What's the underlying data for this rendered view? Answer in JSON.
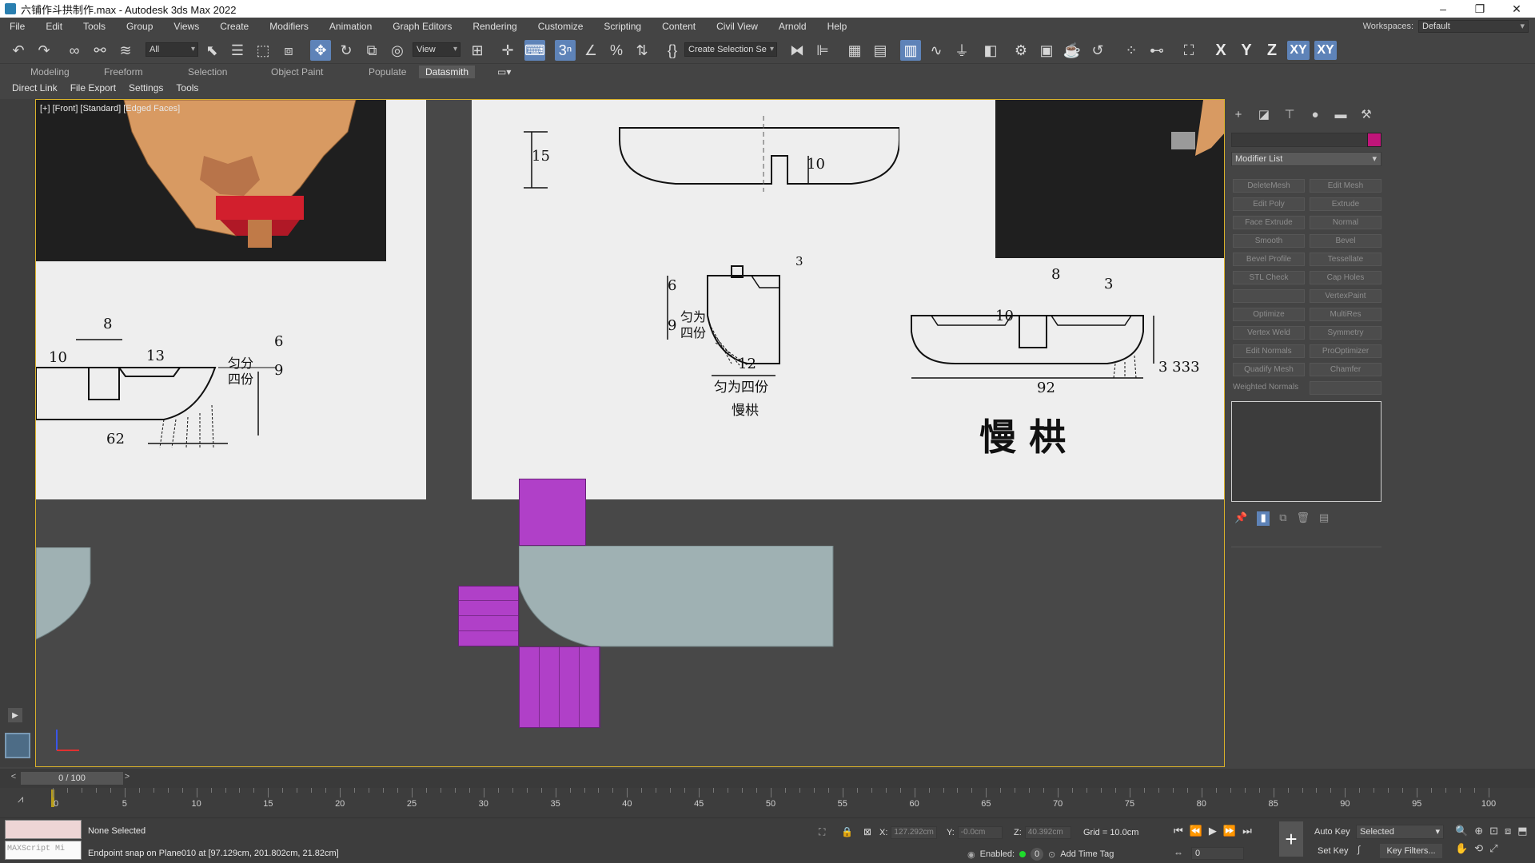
{
  "window": {
    "title": "六铺作斗拱制作.max - Autodesk 3ds Max 2022",
    "controls": [
      "–",
      "❐",
      "✕"
    ]
  },
  "menu": [
    "File",
    "Edit",
    "Tools",
    "Group",
    "Views",
    "Create",
    "Modifiers",
    "Animation",
    "Graph Editors",
    "Rendering",
    "Customize",
    "Scripting",
    "Content",
    "Civil View",
    "Arnold",
    "Help"
  ],
  "workspaces": {
    "label": "Workspaces:",
    "value": "Default"
  },
  "toolbar": {
    "filter_value": "All",
    "ref_coord_value": "View",
    "selection_set_placeholder": "Create Selection Se",
    "axes": [
      "X",
      "Y",
      "Z",
      "XY",
      "XY"
    ]
  },
  "ribbon": {
    "tabs": [
      "Modeling",
      "Freeform",
      "Selection",
      "Object Paint",
      "Populate",
      "Datasmith"
    ],
    "active_tab": "Datasmith",
    "subtabs": [
      "Direct Link",
      "File Export",
      "Settings",
      "Tools"
    ]
  },
  "viewport": {
    "label": "[+] [Front] [Standard] [Edged Faces]",
    "drawing_labels": {
      "dim_15": "15",
      "dim_10_top": "10",
      "dim_8_left": "8",
      "dim_10_left": "10",
      "dim_13_left": "13",
      "dim_6_left": "6",
      "dim_9_left": "9",
      "div4_left": "匀分\n四份",
      "dim_62": "62",
      "dim_3_mid": "3",
      "dim_6_mid": "6",
      "dim_9_mid": "9",
      "div4_mid_side": "匀为\n四份",
      "dim_12_mid": "12",
      "div4_mid": "匀为四份",
      "mangong_small": "慢栱",
      "dim_8_right": "8",
      "dim_3_right": "3",
      "dim_10_right": "10",
      "dim_3333": "3 333",
      "dim_92": "92",
      "mangong_large": "慢  栱"
    },
    "colors": {
      "accent_border": "#d9b12a",
      "purple_mesh": "#b040c8",
      "grey_mesh": "#9fb1b3",
      "blueprint_bg": "#eeeeee",
      "model_wood": "#d89a62",
      "model_red": "#d21f2d"
    }
  },
  "command_panel": {
    "tabs": [
      "create-icon",
      "modify-icon",
      "hierarchy-icon",
      "motion-icon",
      "display-icon",
      "utilities-icon"
    ],
    "object_color": "#c0157a",
    "modifier_list_label": "Modifier List",
    "modifiers": [
      "DeleteMesh",
      "Edit Mesh",
      "Edit Poly",
      "Extrude",
      "Face Extrude",
      "Normal",
      "Smooth",
      "Bevel",
      "Bevel Profile",
      "Tessellate",
      "STL Check",
      "Cap Holes",
      "",
      "VertexPaint",
      "Optimize",
      "MultiRes",
      "Vertex Weld",
      "Symmetry",
      "Edit Normals",
      "ProOptimizer",
      "Quadify Mesh",
      "Chamfer",
      "Weighted Normals",
      ""
    ]
  },
  "time_slider": {
    "value": "0 / 100"
  },
  "trackbar": {
    "ticks": [
      "0",
      "5",
      "10",
      "15",
      "20",
      "25",
      "30",
      "35",
      "40",
      "45",
      "50",
      "55",
      "60",
      "65",
      "70",
      "75",
      "80",
      "85",
      "90",
      "95",
      "100"
    ]
  },
  "status": {
    "selection": "None Selected",
    "prompt": "Endpoint snap on Plane010 at [97.129cm, 201.802cm, 21.82cm]",
    "maxscript_label": "MAXScript Mi",
    "x_label": "X:",
    "x_value": "127.292cm",
    "y_label": "Y:",
    "y_value": "-0.0cm",
    "z_label": "Z:",
    "z_value": "40.392cm",
    "grid": "Grid = 10.0cm",
    "enabled_label": "Enabled:",
    "enabled_value": "0",
    "add_time_tag": "Add Time Tag",
    "auto_key": "Auto Key",
    "set_key": "Set Key",
    "key_mode": "Selected",
    "key_filters": "Key Filters...",
    "frame_value": "0"
  }
}
